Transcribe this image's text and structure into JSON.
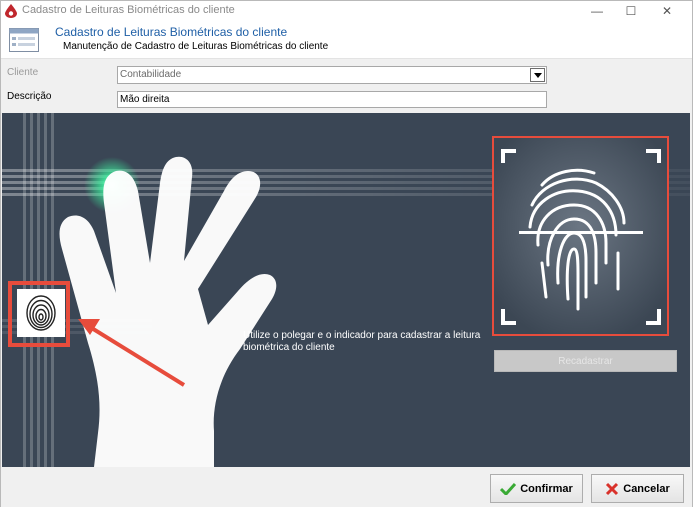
{
  "window": {
    "title": "Cadastro de Leituras Biométricas do cliente",
    "minimize": "—",
    "maximize": "☐",
    "close": "✕"
  },
  "header": {
    "title": "Cadastro de Leituras Biométricas do cliente",
    "subtitle": "Manutenção de Cadastro de Leituras Biométricas do cliente",
    "icon": "form-list-icon"
  },
  "form": {
    "cliente_label": "Cliente",
    "cliente_value": "Contabilidade",
    "descricao_label": "Descrição",
    "descricao_value": "Mão direita"
  },
  "biometric": {
    "instruction": "Utilize o polegar e o indicador para cadastrar a leitura biométrica do cliente",
    "recadastrar_label": "Recadastrar",
    "highlight_color": "#e74c3c",
    "glow_color": "#3ef5a0"
  },
  "footer": {
    "confirm_label": "Confirmar",
    "cancel_label": "Cancelar"
  }
}
